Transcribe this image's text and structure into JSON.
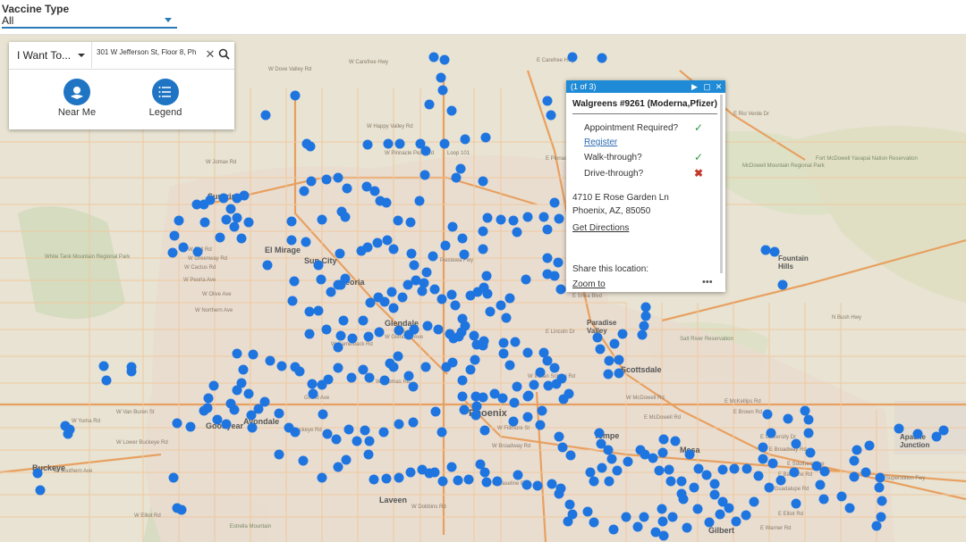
{
  "filter": {
    "label": "Vaccine Type",
    "selected": "All"
  },
  "search": {
    "mode_label": "I Want To...",
    "query": "301 W Jefferson St, Floor 8, Ph",
    "clear_icon": "close-icon",
    "search_icon": "search-icon",
    "tools": [
      {
        "label": "Near Me",
        "icon": "locate-icon"
      },
      {
        "label": "Legend",
        "icon": "list-icon"
      }
    ]
  },
  "popup": {
    "pager": "(1 of 3)",
    "title": "Walgreens #9261 (Moderna,Pfizer)",
    "rows": [
      {
        "label": "Appointment Required?",
        "value": "yes"
      },
      {
        "label": "Walk-through?",
        "value": "yes"
      },
      {
        "label": "Drive-through?",
        "value": "no"
      }
    ],
    "register_link": "Register",
    "address_line1": "4710 E Rose Garden Ln",
    "address_line2": "Phoenix, AZ, 85050",
    "directions_link": "Get Directions",
    "share_label": "Share this location:",
    "zoom_link": "Zoom to",
    "more": "•••",
    "yes_mark": "✓",
    "no_mark": "✖"
  },
  "map": {
    "marker_color": "#1f75e0",
    "cities": [
      "Surprise",
      "El Mirage",
      "Sun City",
      "Peoria",
      "Glendale",
      "Phoenix",
      "Scottsdale",
      "Tempe",
      "Mesa",
      "Gilbert",
      "Goodyear",
      "Avondale",
      "Buckeye",
      "Laveen",
      "Paradise Valley",
      "Fountain Hills",
      "Apache Junction"
    ],
    "regions": [
      "White Tank Mountain Regional Park",
      "McDowell Mountain Regional Park",
      "Fort McDowell Yavapai Nation Reservation",
      "Salt River Reservation",
      "Estrella Mountain"
    ],
    "streets": [
      "W Carefree Hwy",
      "W Dove Valley Rd",
      "E Carefree Hwy",
      "W Happy Valley Rd",
      "W Pinnacle Peak Rd",
      "E Pinnacle Peak",
      "W Jomax Rd",
      "E Rio Verde Dr",
      "W Bell Rd",
      "W Greenway Rd",
      "W Cactus Rd",
      "W Peoria Ave",
      "W Olive Ave",
      "W Northern Ave",
      "W Glendale Ave",
      "W Camelback Rd",
      "W Indian School Rd",
      "W Thomas Rd",
      "W McDowell Rd",
      "W Van Buren St",
      "W Buckeye Rd",
      "W Lower Buckeye Rd",
      "W Broadway Rd",
      "W Southern Ave",
      "W Baseline Rd",
      "W Dobbins Rd",
      "W Elliot Rd",
      "E McDowell Rd",
      "E McKellips Rd",
      "E Brown Rd",
      "E University Dr",
      "E Broadway Rd",
      "E Southern Ave",
      "E Baseline Rd",
      "E Guadalupe Rd",
      "E Elliot Rd",
      "E Warner Rd",
      "Superstition Fwy",
      "Grand Ave",
      "Piestewa Fwy",
      "Loop 101",
      "E Shea Blvd",
      "E Lincoln Dr",
      "N Bush Hwy",
      "W Yuma Rd",
      "W Fillmore St"
    ]
  }
}
